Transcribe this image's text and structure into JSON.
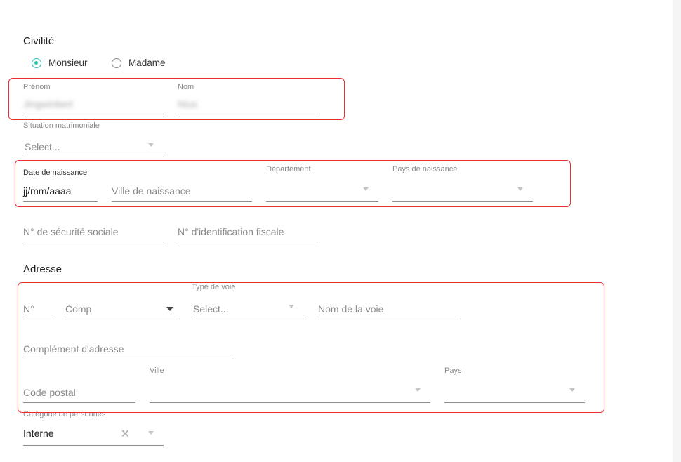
{
  "civilite": {
    "title": "Civilité",
    "options": [
      {
        "label": "Monsieur",
        "checked": true
      },
      {
        "label": "Madame",
        "checked": false
      }
    ]
  },
  "identity": {
    "prenom_label": "Prénom",
    "prenom_value": "Jingwinbert",
    "nom_label": "Nom",
    "nom_value": "Nius"
  },
  "situation": {
    "label": "Situation matrimoniale",
    "placeholder": "Select..."
  },
  "birth": {
    "date_label": "Date de naissance",
    "date_value": "jj/mm/aaaa",
    "ville_placeholder": "Ville de naissance",
    "departement_label": "Département",
    "pays_label": "Pays de naissance"
  },
  "ids": {
    "secu_placeholder": "N° de sécurité sociale",
    "fiscal_placeholder": "N° d'identification fiscale"
  },
  "adresse": {
    "title": "Adresse",
    "numero_placeholder": "N°",
    "comp_placeholder": "Comp",
    "type_voie_label": "Type de voie",
    "type_voie_placeholder": "Select...",
    "nom_voie_placeholder": "Nom de la voie",
    "complement_placeholder": "Complément d'adresse",
    "code_postal_placeholder": "Code postal",
    "ville_label": "Ville",
    "pays_label": "Pays"
  },
  "categorie": {
    "label": "Catégorie de personnes",
    "value": "Interne"
  },
  "colors": {
    "accent": "#2ec5b6",
    "highlight": "#ee2b2b"
  },
  "icons": [
    "radio-checked-icon",
    "radio-unchecked-icon",
    "chevron-down-icon",
    "close-icon"
  ]
}
